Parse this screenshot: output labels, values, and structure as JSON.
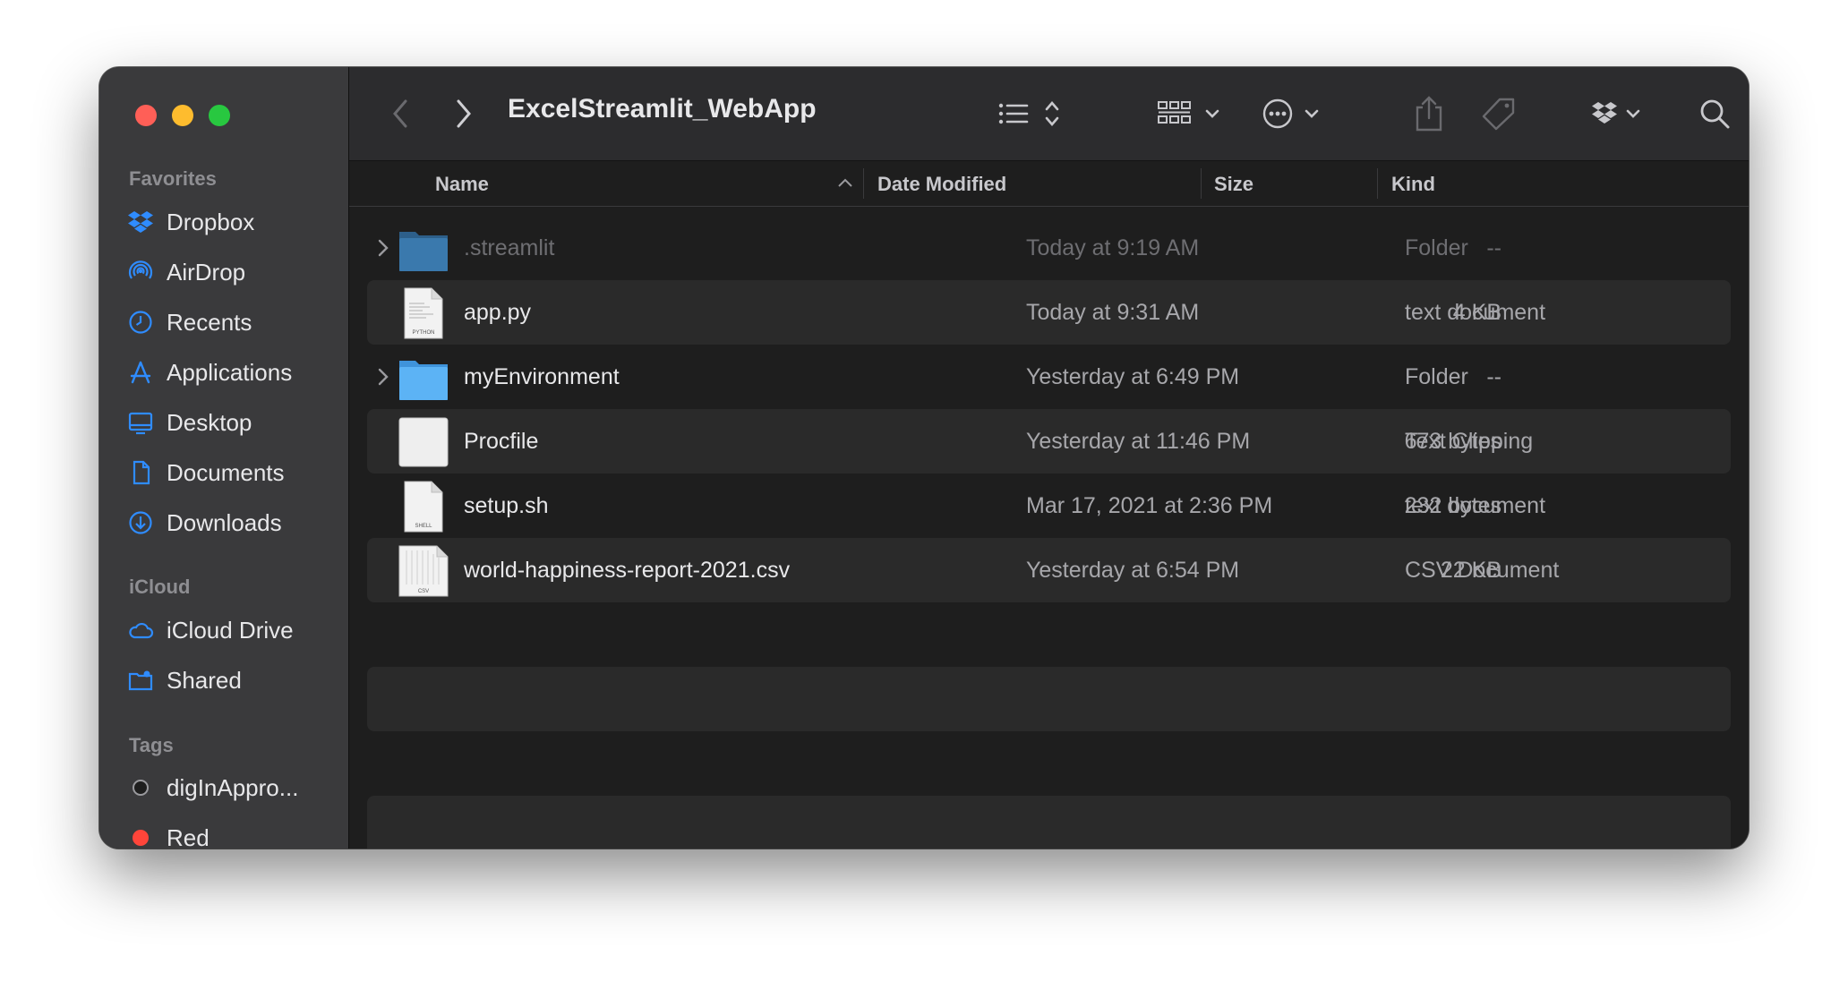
{
  "window": {
    "title": "ExcelStreamlit_WebApp"
  },
  "sidebar": {
    "favorites_heading": "Favorites",
    "favorites": [
      {
        "label": "Dropbox",
        "icon": "dropbox-icon"
      },
      {
        "label": "AirDrop",
        "icon": "airdrop-icon"
      },
      {
        "label": "Recents",
        "icon": "clock-icon"
      },
      {
        "label": "Applications",
        "icon": "applications-icon"
      },
      {
        "label": "Desktop",
        "icon": "desktop-icon"
      },
      {
        "label": "Documents",
        "icon": "document-icon"
      },
      {
        "label": "Downloads",
        "icon": "download-icon"
      }
    ],
    "icloud_heading": "iCloud",
    "icloud": [
      {
        "label": "iCloud Drive",
        "icon": "cloud-icon"
      },
      {
        "label": "Shared",
        "icon": "shared-folder-icon"
      }
    ],
    "tags_heading": "Tags",
    "tags": [
      {
        "label": "digInAppro...",
        "color": "#1e1e1e"
      },
      {
        "label": "Red",
        "color": "#ff453a"
      }
    ]
  },
  "toolbar": {
    "back_icon": "chevron-left-icon",
    "forward_icon": "chevron-right-icon",
    "view_icon": "list-view-icon",
    "group_icon": "grid-group-icon",
    "action_icon": "ellipsis-circle-icon",
    "share_icon": "share-icon",
    "tag_icon": "tag-icon",
    "dropbox_icon": "dropbox-icon",
    "search_icon": "search-icon"
  },
  "columns": {
    "name": "Name",
    "date": "Date Modified",
    "size": "Size",
    "kind": "Kind"
  },
  "files": [
    {
      "name": ".streamlit",
      "date": "Today at 9:19 AM",
      "size": "--",
      "kind": "Folder",
      "type": "folder",
      "dim": true
    },
    {
      "name": "app.py",
      "date": "Today at 9:31 AM",
      "size": "4 KB",
      "kind": "text document",
      "type": "doc",
      "badge": "PYTHON"
    },
    {
      "name": "myEnvironment",
      "date": "Yesterday at 6:49 PM",
      "size": "--",
      "kind": "Folder",
      "type": "folder"
    },
    {
      "name": "Procfile",
      "date": "Yesterday at 11:46 PM",
      "size": "673 bytes",
      "kind": "Text Clipping",
      "type": "clipping"
    },
    {
      "name": "setup.sh",
      "date": "Mar 17, 2021 at 2:36 PM",
      "size": "232 bytes",
      "kind": "text document",
      "type": "doc",
      "badge": "SHELL"
    },
    {
      "name": "world-happiness-report-2021.csv",
      "date": "Yesterday at 6:54 PM",
      "size": "22 KB",
      "kind": "CSV Document",
      "type": "doc",
      "badge": "CSV"
    }
  ],
  "colors": {
    "accent": "#2f8cff",
    "folder": "#4aa3f0",
    "sidebar_bg": "#3a3a3c",
    "window_bg": "#1e1e1e"
  }
}
